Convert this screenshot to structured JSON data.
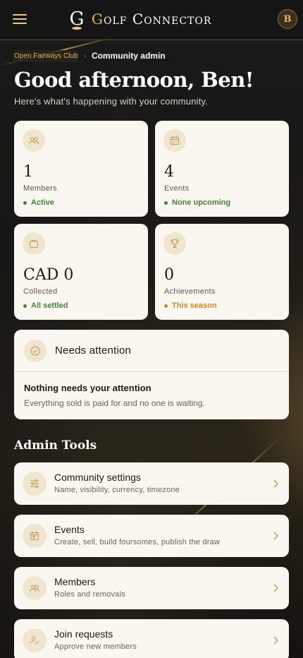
{
  "header": {
    "brand_name_initial": "G",
    "brand_name_rest": "olf Connector",
    "brand_mark": "G",
    "avatar_initial": "B",
    "menu_icon": "hamburger-menu-icon"
  },
  "breadcrumb": {
    "items": [
      "Open Fairways Club",
      "Community admin"
    ],
    "separator": "›"
  },
  "greeting": {
    "title": "Good afternoon, Ben!",
    "subtitle": "Here's what's happening with your community."
  },
  "stats": [
    {
      "icon": "users-icon",
      "value": "1",
      "label": "Members",
      "status": "Active",
      "status_color": "#4a7d3a"
    },
    {
      "icon": "calendar-icon",
      "value": "4",
      "label": "Events",
      "status": "None upcoming",
      "status_color": "#4a7d3a"
    },
    {
      "icon": "bag-icon",
      "value": "CAD 0",
      "label": "Collected",
      "status": "All settled",
      "status_color": "#4a7d3a"
    },
    {
      "icon": "trophy-icon",
      "value": "0",
      "label": "Achievements",
      "status": "This season",
      "status_color": "#c9852a"
    }
  ],
  "attention": {
    "title": "Needs attention",
    "main": "Nothing needs your attention",
    "desc": "Everything sold is paid for and no one is waiting."
  },
  "tools": {
    "title": "Admin Tools",
    "items": [
      {
        "icon": "sliders-icon",
        "title": "Community settings",
        "desc": "Name, visibility, currency, timezone"
      },
      {
        "icon": "calendar-icon",
        "title": "Events",
        "desc": "Create, sell, build foursomes, publish the draw"
      },
      {
        "icon": "users-icon",
        "title": "Members",
        "desc": "Roles and removals"
      },
      {
        "icon": "user-check-icon",
        "title": "Join requests",
        "desc": "Approve new members"
      }
    ]
  },
  "colors": {
    "accent": "#d9b066",
    "card": "#faf7f0",
    "icon_bg": "#efe5d1"
  }
}
